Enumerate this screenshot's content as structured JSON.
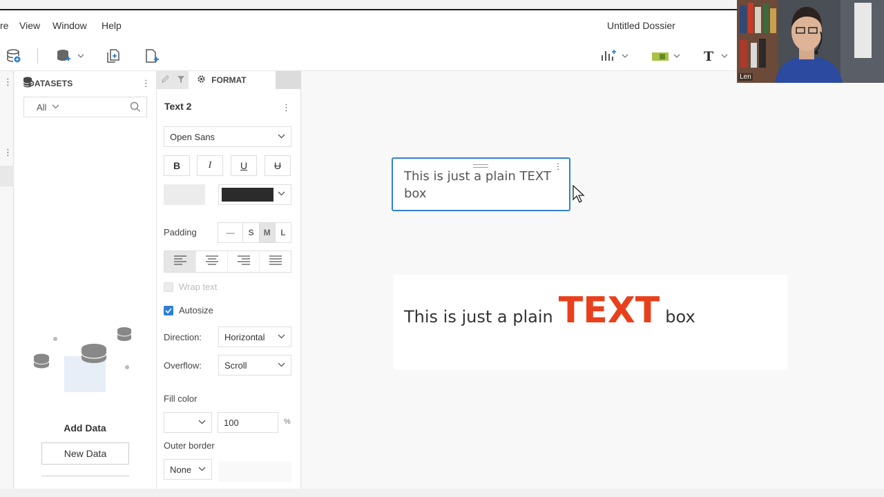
{
  "menu": {
    "items": [
      "re",
      "View",
      "Window",
      "Help"
    ],
    "document_title": "Untitled Dossier"
  },
  "toolbar": {
    "left_icons": [
      "data-source-icon",
      "add-dataset-icon",
      "duplicate-page-icon",
      "new-page-icon"
    ],
    "right_icons": [
      "insert-visualization-icon",
      "insert-filter-icon",
      "insert-text-icon"
    ]
  },
  "datasets": {
    "header": "DATASETS",
    "filter_value": "All",
    "add_data_label": "Add Data",
    "new_data_button": "New Data"
  },
  "format_panel": {
    "tab_label": "FORMAT",
    "element_title": "Text 2",
    "font_family": "Open Sans",
    "style_buttons": [
      "B",
      "I",
      "U",
      "U"
    ],
    "text_color": "#2b2b2b",
    "padding_label": "Padding",
    "padding_options": [
      "—",
      "S",
      "M",
      "L"
    ],
    "padding_selected": "M",
    "wrap_text_label": "Wrap text",
    "wrap_text_checked": false,
    "autosize_label": "Autosize",
    "autosize_checked": true,
    "direction_label": "Direction:",
    "direction_value": "Horizontal",
    "overflow_label": "Overflow:",
    "overflow_value": "Scroll",
    "fill_color_label": "Fill color",
    "fill_opacity": "100",
    "fill_opacity_unit": "%",
    "outer_border_label": "Outer border",
    "outer_border_value": "None"
  },
  "canvas": {
    "textbox1_text": "This is just a plain TEXT box",
    "textbox2_prefix": "This is just a plain",
    "textbox2_highlight": "TEXT",
    "textbox2_suffix": "box",
    "highlight_color": "#e8401c",
    "selection_color": "#2f7fd8"
  },
  "webcam": {
    "participant_name": "Len"
  }
}
